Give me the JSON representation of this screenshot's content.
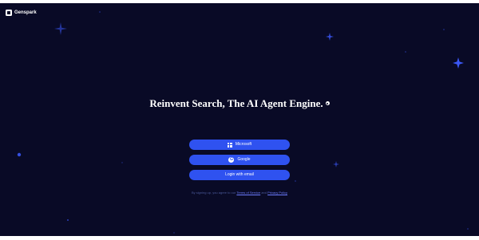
{
  "brand": {
    "name": "Genspark",
    "icon": "genspark-logo-icon"
  },
  "hero": {
    "headline": "Reinvent Search, The AI Agent Engine.",
    "headline_icon": "spark-dot-icon"
  },
  "auth": {
    "microsoft_label": "Microsoft",
    "google_label": "Google",
    "email_label": "Login with email",
    "microsoft_icon": "microsoft-icon",
    "google_icon": "google-icon"
  },
  "terms": {
    "prefix": "By signing up, you agree to our",
    "terms_link": "Terms of Service",
    "joiner": "and",
    "privacy_link": "Privacy Policy"
  },
  "colors": {
    "background": "#090a26",
    "button": "#2f52f0",
    "sparkle": "#3b57f5"
  }
}
